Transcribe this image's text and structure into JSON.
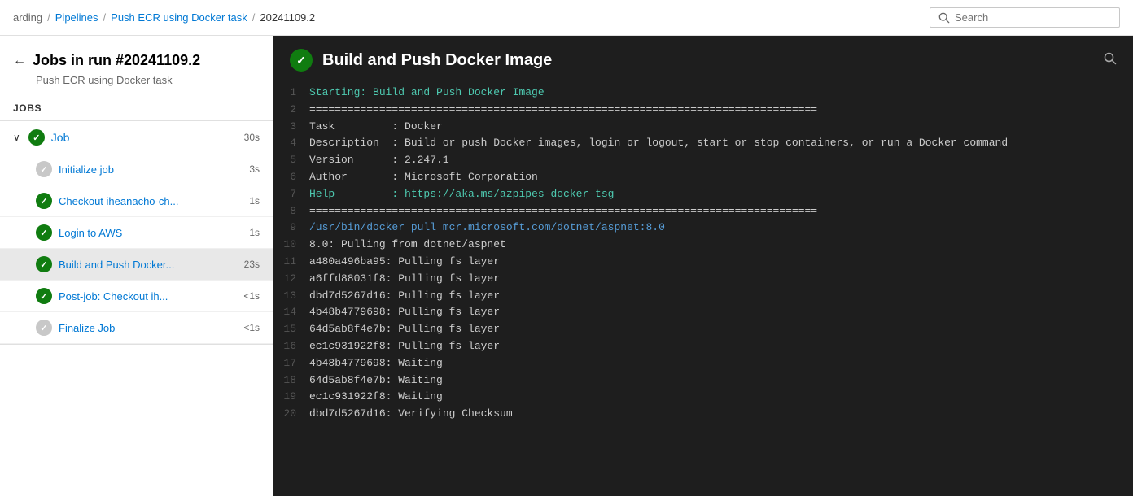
{
  "breadcrumb": {
    "items": [
      "arding",
      "Pipelines",
      "Push ECR using Docker task",
      "20241109.2"
    ]
  },
  "search": {
    "placeholder": "Search"
  },
  "sidebar": {
    "back_label": "←",
    "run_title": "Jobs in run #20241109.2",
    "run_subtitle": "Push ECR using Docker task",
    "jobs_section_label": "Jobs",
    "job": {
      "name": "Job",
      "time": "30s",
      "steps": [
        {
          "name": "Initialize job",
          "time": "3s",
          "status": "gray"
        },
        {
          "name": "Checkout iheanacho-ch...",
          "time": "1s",
          "status": "green"
        },
        {
          "name": "Login to AWS",
          "time": "1s",
          "status": "green"
        },
        {
          "name": "Build and Push Docker...",
          "time": "23s",
          "status": "green",
          "selected": true
        },
        {
          "name": "Post-job: Checkout ih...",
          "time": "<1s",
          "status": "green"
        },
        {
          "name": "Finalize Job",
          "time": "<1s",
          "status": "gray"
        }
      ]
    }
  },
  "log": {
    "title": "Build and Push Docker Image",
    "lines": [
      {
        "num": 1,
        "text": "Starting: Build and Push Docker Image",
        "style": "green"
      },
      {
        "num": 2,
        "text": "================================================================================",
        "style": "normal"
      },
      {
        "num": 3,
        "text": "Task         : Docker",
        "style": "normal"
      },
      {
        "num": 4,
        "text": "Description  : Build or push Docker images, login or logout, start or stop containers, or run a Docker command",
        "style": "normal"
      },
      {
        "num": 5,
        "text": "Version      : 2.247.1",
        "style": "normal"
      },
      {
        "num": 6,
        "text": "Author       : Microsoft Corporation",
        "style": "normal"
      },
      {
        "num": 7,
        "text": "Help         : https://aka.ms/azpipes-docker-tsg",
        "style": "link"
      },
      {
        "num": 8,
        "text": "================================================================================",
        "style": "normal"
      },
      {
        "num": 9,
        "text": "/usr/bin/docker pull mcr.microsoft.com/dotnet/aspnet:8.0",
        "style": "blue"
      },
      {
        "num": 10,
        "text": "8.0: Pulling from dotnet/aspnet",
        "style": "normal"
      },
      {
        "num": 11,
        "text": "a480a496ba95: Pulling fs layer",
        "style": "normal"
      },
      {
        "num": 12,
        "text": "a6ffd88031f8: Pulling fs layer",
        "style": "normal"
      },
      {
        "num": 13,
        "text": "dbd7d5267d16: Pulling fs layer",
        "style": "normal"
      },
      {
        "num": 14,
        "text": "4b48b4779698: Pulling fs layer",
        "style": "normal"
      },
      {
        "num": 15,
        "text": "64d5ab8f4e7b: Pulling fs layer",
        "style": "normal"
      },
      {
        "num": 16,
        "text": "ec1c931922f8: Pulling fs layer",
        "style": "normal"
      },
      {
        "num": 17,
        "text": "4b48b4779698: Waiting",
        "style": "normal"
      },
      {
        "num": 18,
        "text": "64d5ab8f4e7b: Waiting",
        "style": "normal"
      },
      {
        "num": 19,
        "text": "ec1c931922f8: Waiting",
        "style": "normal"
      },
      {
        "num": 20,
        "text": "dbd7d5267d16: Verifying Checksum",
        "style": "normal"
      }
    ]
  }
}
